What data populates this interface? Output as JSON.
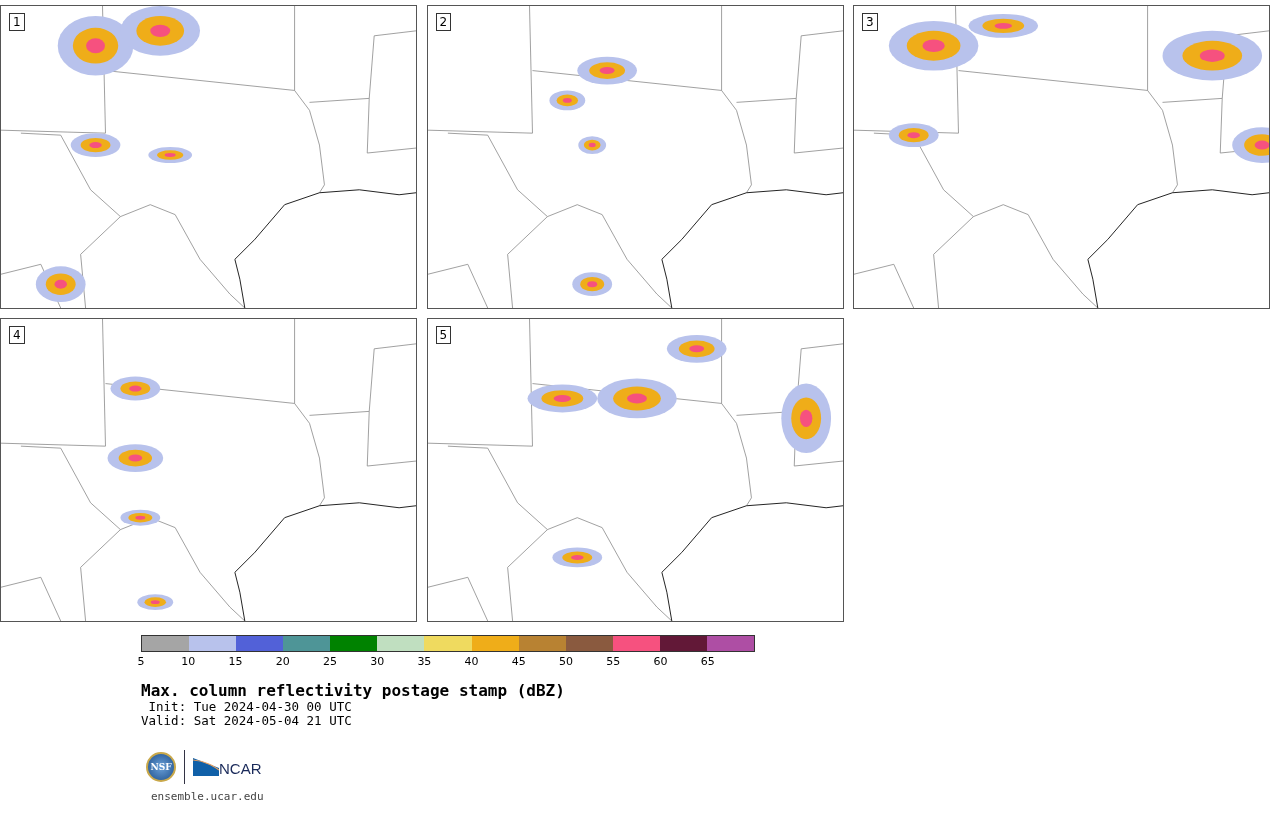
{
  "panels": [
    {
      "label": "1"
    },
    {
      "label": "2"
    },
    {
      "label": "3"
    },
    {
      "label": "4"
    },
    {
      "label": "5"
    }
  ],
  "colorbar": {
    "bins": [
      {
        "color": "#a5a5a5"
      },
      {
        "color": "#b8c2ec"
      },
      {
        "color": "#5261d8"
      },
      {
        "color": "#4e9597"
      },
      {
        "color": "#008200"
      },
      {
        "color": "#c0dfc0"
      },
      {
        "color": "#efda5f"
      },
      {
        "color": "#efad19"
      },
      {
        "color": "#b88232"
      },
      {
        "color": "#8a5a3f"
      },
      {
        "color": "#f6517f"
      },
      {
        "color": "#621837"
      },
      {
        "color": "#ae4ea4"
      }
    ],
    "ticks": [
      "5",
      "10",
      "15",
      "20",
      "25",
      "30",
      "35",
      "40",
      "45",
      "50",
      "55",
      "60",
      "65"
    ]
  },
  "title": "Max. column reflectivity postage stamp (dBZ)",
  "init": " Init: Tue 2024-04-30 00 UTC",
  "valid": "Valid: Sat 2024-05-04 21 UTC",
  "logos": {
    "nsf": "NSF",
    "ncar": "NCAR"
  },
  "url": "ensemble.ucar.edu"
}
